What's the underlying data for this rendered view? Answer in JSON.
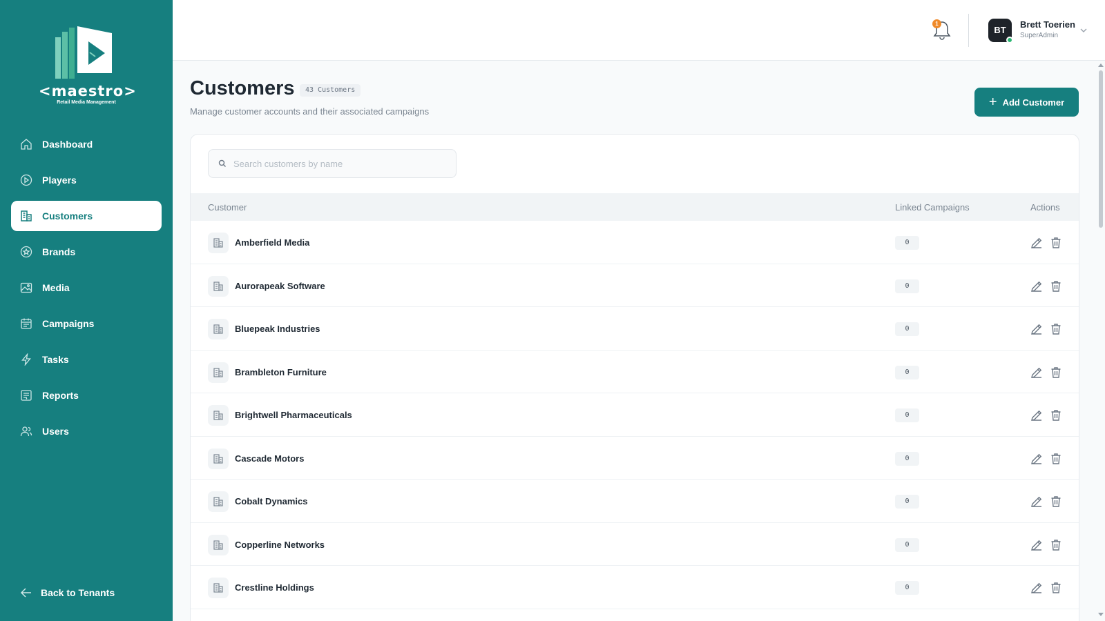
{
  "app": {
    "logo_text": "<maestro>",
    "logo_subtitle": "Retail Media Management"
  },
  "sidebar": {
    "items": [
      {
        "label": "Dashboard",
        "icon": "home-icon"
      },
      {
        "label": "Players",
        "icon": "play-circle-icon"
      },
      {
        "label": "Customers",
        "icon": "building-icon",
        "active": true
      },
      {
        "label": "Brands",
        "icon": "star-circle-icon"
      },
      {
        "label": "Media",
        "icon": "image-icon"
      },
      {
        "label": "Campaigns",
        "icon": "calendar-icon"
      },
      {
        "label": "Tasks",
        "icon": "lightning-icon"
      },
      {
        "label": "Reports",
        "icon": "report-icon"
      },
      {
        "label": "Users",
        "icon": "users-icon"
      }
    ],
    "back_label": "Back to Tenants"
  },
  "header": {
    "notification_count": "1",
    "user": {
      "initials": "BT",
      "name": "Brett Toerien",
      "role": "SuperAdmin"
    }
  },
  "page": {
    "title": "Customers",
    "count_label": "43 Customers",
    "subtitle": "Manage customer accounts and their associated campaigns",
    "add_button_label": "Add Customer"
  },
  "search": {
    "placeholder": "Search customers by name",
    "value": ""
  },
  "table": {
    "columns": {
      "customer": "Customer",
      "linked": "Linked Campaigns",
      "actions": "Actions"
    },
    "rows": [
      {
        "name": "Amberfield Media",
        "linked": "0"
      },
      {
        "name": "Aurorapeak Software",
        "linked": "0"
      },
      {
        "name": "Bluepeak Industries",
        "linked": "0"
      },
      {
        "name": "Brambleton Furniture",
        "linked": "0"
      },
      {
        "name": "Brightwell Pharmaceuticals",
        "linked": "0"
      },
      {
        "name": "Cascade Motors",
        "linked": "0"
      },
      {
        "name": "Cobalt Dynamics",
        "linked": "0"
      },
      {
        "name": "Copperline Networks",
        "linked": "0"
      },
      {
        "name": "Crestline Holdings",
        "linked": "0"
      }
    ]
  },
  "colors": {
    "brand": "#167f7f",
    "sidebar_bg": "#167f7f",
    "badge": "#ef8a2a",
    "online": "#2bb673"
  }
}
